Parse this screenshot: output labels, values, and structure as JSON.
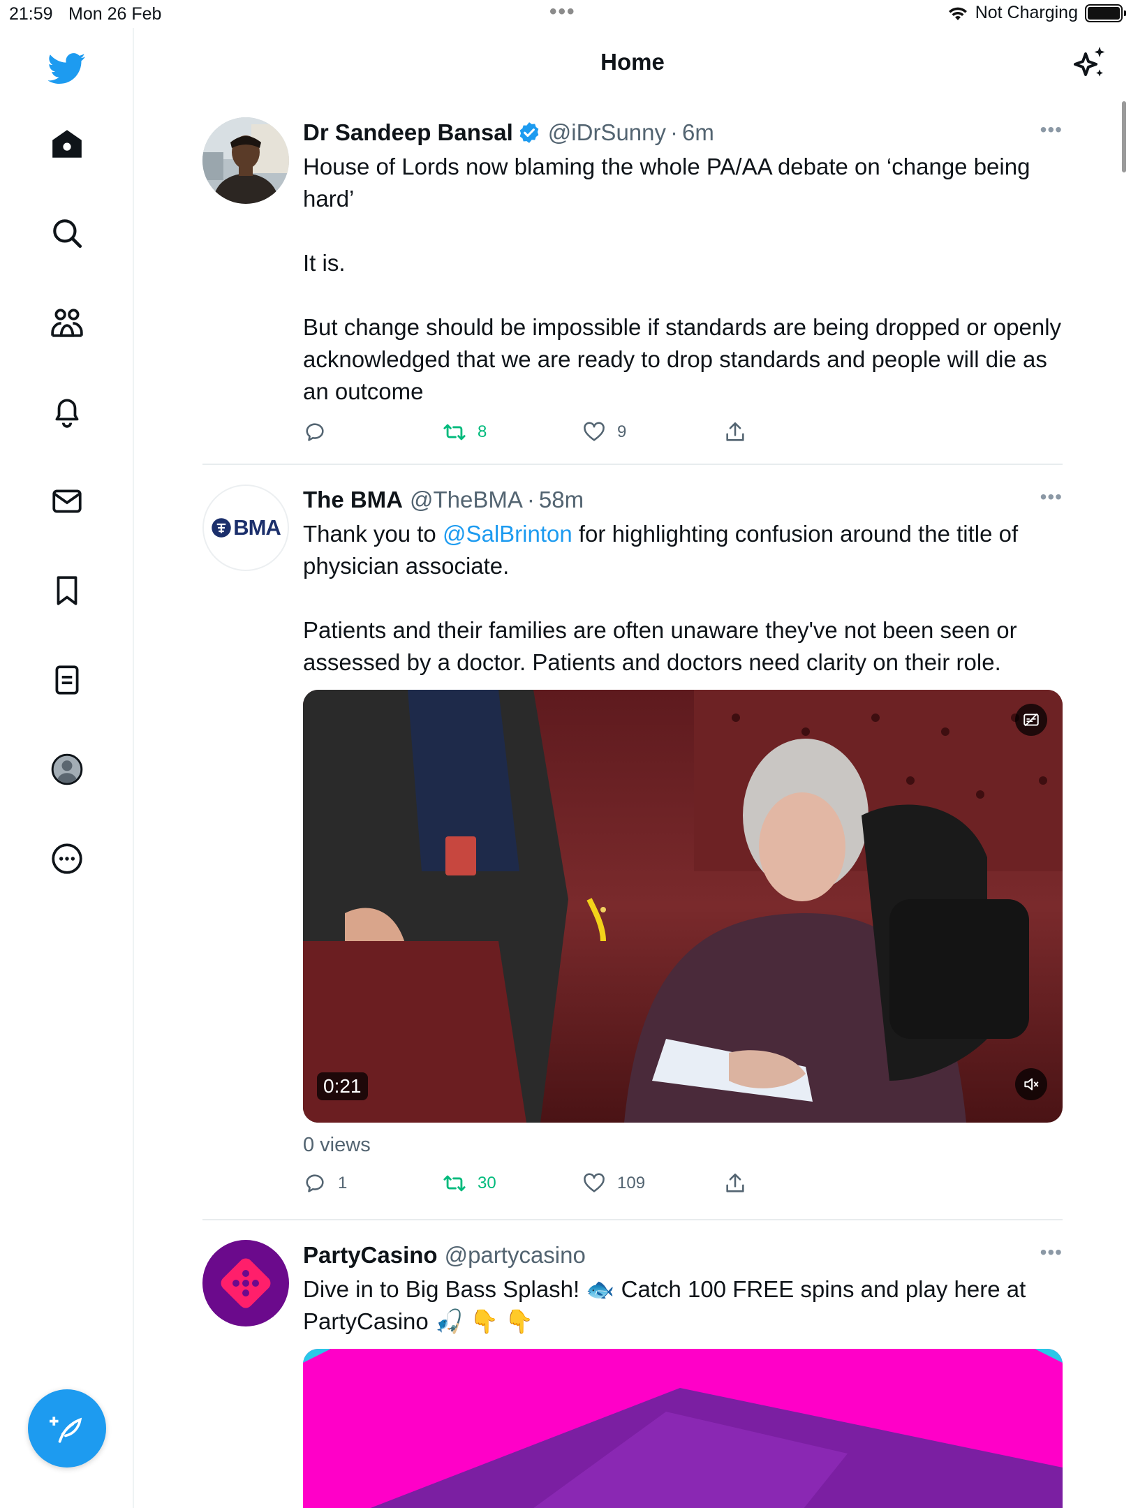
{
  "status_bar": {
    "time": "21:59",
    "date": "Mon 26 Feb",
    "charging": "Not Charging"
  },
  "header": {
    "title": "Home"
  },
  "sidebar": {
    "items": [
      "twitter-logo",
      "home",
      "search",
      "communities",
      "notifications",
      "messages",
      "bookmarks",
      "lists",
      "profile",
      "more"
    ]
  },
  "tweets": [
    {
      "name": "Dr Sandeep Bansal",
      "verified": true,
      "handle": "@iDrSunny",
      "time": "6m",
      "text": [
        "House of Lords now blaming the whole PA/AA debate on ‘change being hard’",
        "It is.",
        "But change should be impossible if standards are being dropped or openly acknowledged that we are ready to drop standards and people will die as an outcome"
      ],
      "replies": "",
      "retweets": "8",
      "likes": "9"
    },
    {
      "name": "The BMA",
      "handle": "@TheBMA",
      "time": "58m",
      "avatar_text": "BMA",
      "text_pre": "Thank you to ",
      "mention": "@SalBrinton",
      "text_post": " for highlighting confusion around the title of physician associate.",
      "text_2": "Patients and their families are often unaware they've not been seen or assessed by a doctor. Patients and doctors need clarity on their role.",
      "video_duration": "0:21",
      "views": "0 views",
      "replies": "1",
      "retweets": "30",
      "likes": "109"
    },
    {
      "name": "PartyCasino",
      "handle": "@partycasino",
      "text": "Dive in to Big Bass Splash! 🐟 Catch 100 FREE spins and play here at PartyCasino 🎣 👇 👇"
    }
  ],
  "colors": {
    "accent": "#1d9bf0",
    "retweet_green": "#00ba7c",
    "secondary_text": "#536471",
    "casino_purple": "#6b0a8c",
    "casino_pink": "#ff1493"
  }
}
